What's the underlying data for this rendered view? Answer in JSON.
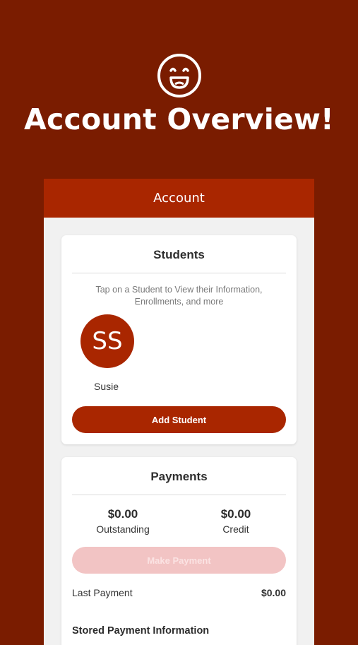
{
  "hero": {
    "title": "Account Overview!",
    "icon": "smiley-face-icon"
  },
  "appbar": {
    "title": "Account"
  },
  "students": {
    "title": "Students",
    "hint": "Tap on a Student to View their Information, Enrollments, and more",
    "list": [
      {
        "initials": "SS",
        "name": "Susie"
      }
    ],
    "add_label": "Add Student"
  },
  "payments": {
    "title": "Payments",
    "outstanding": {
      "value": "$0.00",
      "label": "Outstanding"
    },
    "credit": {
      "value": "$0.00",
      "label": "Credit"
    },
    "make_payment_label": "Make Payment",
    "last_payment": {
      "label": "Last Payment",
      "value": "$0.00"
    },
    "stored_title": "Stored Payment Information"
  },
  "colors": {
    "background": "#7a1c00",
    "accent": "#a92600",
    "disabled": "#f2c4c4"
  }
}
